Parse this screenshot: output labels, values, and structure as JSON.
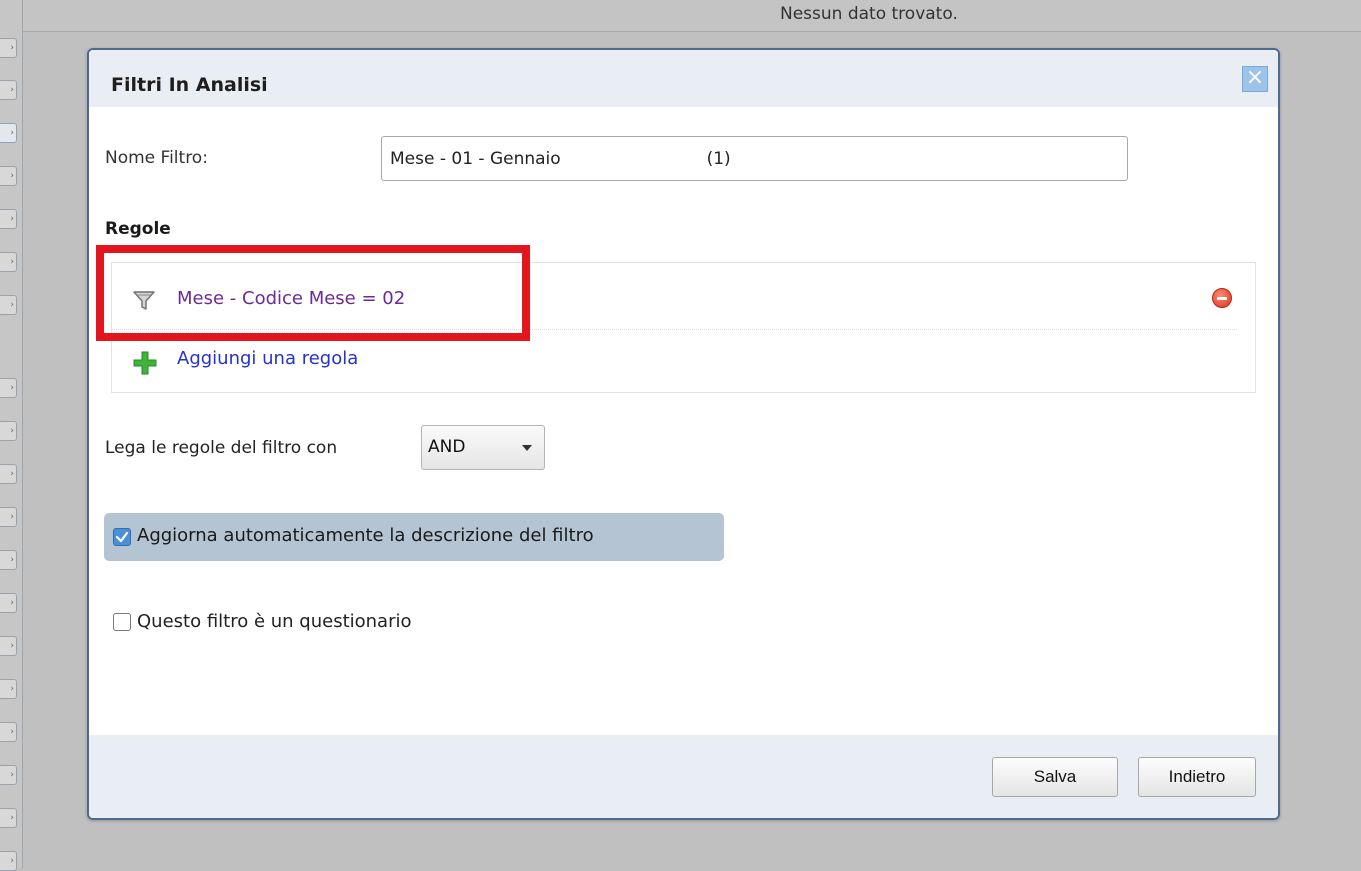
{
  "background": {
    "status_text": "Nessun dato trovato."
  },
  "dialog": {
    "title": "Filtri In Analisi",
    "close_glyph": "×",
    "name_label": "Nome Filtro:",
    "name_value": "Mese - 01 - Gennaio                           (1)",
    "rules_heading": "Regole",
    "rules": [
      {
        "text": "Mese - Codice Mese = 02",
        "icon": "funnel-icon"
      }
    ],
    "add_rule_label": "Aggiungi una regola",
    "combine_label": "Lega le regole del filtro con",
    "combine_value": "AND",
    "auto_description": {
      "label": "Aggiorna automaticamente la descrizione del filtro",
      "checked": true
    },
    "questionnaire": {
      "label": "Questo filtro è un questionario",
      "checked": false
    },
    "buttons": {
      "save": "Salva",
      "back": "Indietro"
    }
  },
  "colors": {
    "highlight": "#e3161f",
    "rule_text": "#6c2a96",
    "link": "#2433c9",
    "dialog_border": "#4e6a8c"
  }
}
